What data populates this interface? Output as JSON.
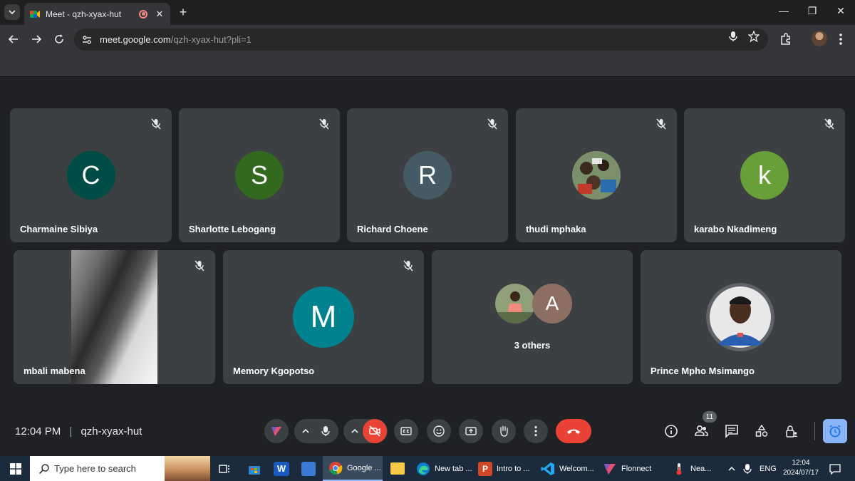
{
  "browser": {
    "tab_title": "Meet - qzh-xyax-hut",
    "url_host": "meet.google.com",
    "url_path": "/qzh-xyax-hut?pli=1"
  },
  "participants_row1": [
    {
      "name": "Charmaine Sibiya",
      "initial": "C",
      "color": "#004d47"
    },
    {
      "name": "Sharlotte Lebogang",
      "initial": "S",
      "color": "#33691e"
    },
    {
      "name": "Richard Choene",
      "initial": "R",
      "color": "#455a64"
    },
    {
      "name": "thudi mphaka",
      "initial": "",
      "color": "#6a7a5a"
    },
    {
      "name": "karabo Nkadimeng",
      "initial": "k",
      "color": "#689f38"
    }
  ],
  "participants_row2": [
    {
      "name": "mbali mabena"
    },
    {
      "name": "Memory Kgopotso",
      "initial": "M",
      "color": "#00838f"
    },
    {
      "others_label": "3 others",
      "initial": "A",
      "color": "#8d6e63"
    },
    {
      "name": "Prince Mpho Msimango"
    }
  ],
  "meeting": {
    "time": "12:04 PM",
    "separator": "|",
    "code": "qzh-xyax-hut",
    "people_count": "11"
  },
  "colors": {
    "end_call": "#ea4335",
    "cam_off": "#ea4335",
    "timer_btn": "#8ab4f8"
  },
  "taskbar": {
    "search_placeholder": "Type here to search",
    "apps": [
      {
        "label": "Google ..."
      },
      {
        "label": "New tab ..."
      },
      {
        "label": "Intro to ..."
      },
      {
        "label": "Welcom..."
      },
      {
        "label": "Flonnect"
      },
      {
        "label": "Nea..."
      }
    ],
    "lang": "ENG",
    "time": "12:04",
    "date": "2024/07/17"
  }
}
